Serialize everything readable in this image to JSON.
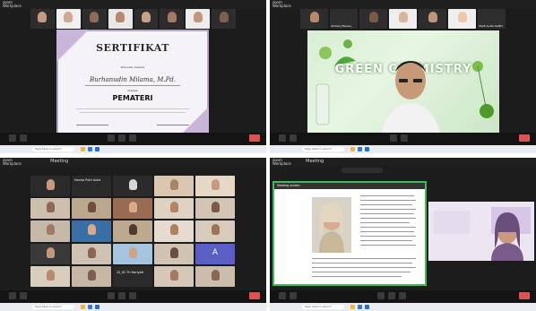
{
  "q1": {
    "window_title": "Zoom Meeting",
    "strip_names": [
      "",
      "",
      "",
      "",
      "",
      "",
      "",
      ""
    ],
    "certificate": {
      "title": "SERTIFIKAT",
      "number": "",
      "given_to": "Diberikan Kepada",
      "name": "Burhanudin Milama, M.Pd.",
      "as": "Sebagai",
      "role": "PEMATERI"
    },
    "taskbar": {
      "search": "Type here to search",
      "weather": "",
      "time": "",
      "date": ""
    }
  },
  "q2": {
    "strip_names": [
      "",
      "Ahmad_Fauzan_",
      "",
      "",
      "",
      "",
      "Shefi Audia Saffirl"
    ],
    "banner_text": "GREEN CHEMISTRY",
    "taskbar": {
      "search": "Type here to search",
      "time": "",
      "date": ""
    }
  },
  "q3": {
    "window_title": "Meeting",
    "cells": [
      "",
      "Hanna Putri Aulia",
      "",
      "",
      "",
      "",
      "",
      "",
      "",
      "",
      "",
      "",
      "",
      "",
      "",
      "",
      "",
      "",
      "",
      "A",
      "",
      "",
      "22_SC Tri Hariyati",
      "",
      ""
    ],
    "taskbar": {
      "search": "Type here to search",
      "time": "",
      "date": ""
    }
  },
  "q4": {
    "window_title": "Meeting",
    "share_bar": "Viewing screen",
    "taskbar": {
      "search": "Type here to search",
      "time": "",
      "date": ""
    }
  }
}
